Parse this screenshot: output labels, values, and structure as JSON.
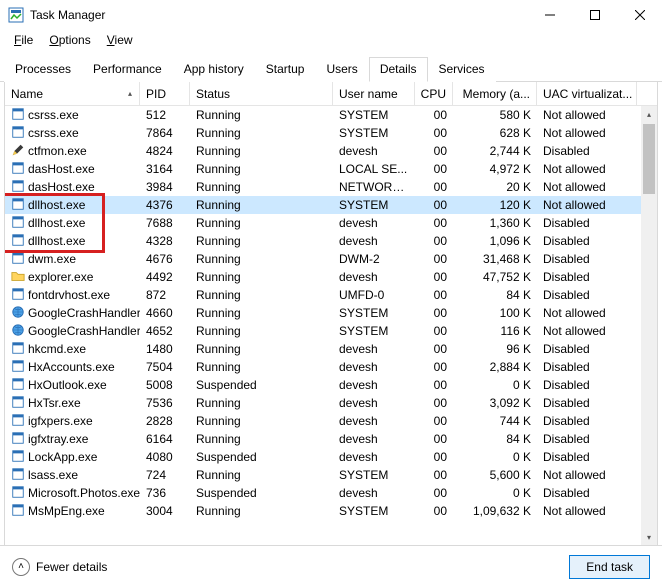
{
  "window": {
    "title": "Task Manager"
  },
  "menu": {
    "file": "File",
    "options": "Options",
    "view": "View"
  },
  "tabs": [
    "Processes",
    "Performance",
    "App history",
    "Startup",
    "Users",
    "Details",
    "Services"
  ],
  "active_tab_index": 5,
  "columns": {
    "name": "Name",
    "pid": "PID",
    "status": "Status",
    "user": "User name",
    "cpu": "CPU",
    "mem": "Memory (a...",
    "uac": "UAC virtualizat..."
  },
  "footer": {
    "fewer": "Fewer details",
    "endtask": "End task"
  },
  "rows": [
    {
      "name": "csrss.exe",
      "pid": "512",
      "status": "Running",
      "user": "SYSTEM",
      "cpu": "00",
      "mem": "580 K",
      "uac": "Not allowed",
      "icon": "app",
      "sel": false
    },
    {
      "name": "csrss.exe",
      "pid": "7864",
      "status": "Running",
      "user": "SYSTEM",
      "cpu": "00",
      "mem": "628 K",
      "uac": "Not allowed",
      "icon": "app",
      "sel": false
    },
    {
      "name": "ctfmon.exe",
      "pid": "4824",
      "status": "Running",
      "user": "devesh",
      "cpu": "00",
      "mem": "2,744 K",
      "uac": "Disabled",
      "icon": "pen",
      "sel": false
    },
    {
      "name": "dasHost.exe",
      "pid": "3164",
      "status": "Running",
      "user": "LOCAL SE...",
      "cpu": "00",
      "mem": "4,972 K",
      "uac": "Not allowed",
      "icon": "app",
      "sel": false
    },
    {
      "name": "dasHost.exe",
      "pid": "3984",
      "status": "Running",
      "user": "NETWORK...",
      "cpu": "00",
      "mem": "20 K",
      "uac": "Not allowed",
      "icon": "app",
      "sel": false
    },
    {
      "name": "dllhost.exe",
      "pid": "4376",
      "status": "Running",
      "user": "SYSTEM",
      "cpu": "00",
      "mem": "120 K",
      "uac": "Not allowed",
      "icon": "app",
      "sel": true
    },
    {
      "name": "dllhost.exe",
      "pid": "7688",
      "status": "Running",
      "user": "devesh",
      "cpu": "00",
      "mem": "1,360 K",
      "uac": "Disabled",
      "icon": "app",
      "sel": false
    },
    {
      "name": "dllhost.exe",
      "pid": "4328",
      "status": "Running",
      "user": "devesh",
      "cpu": "00",
      "mem": "1,096 K",
      "uac": "Disabled",
      "icon": "app",
      "sel": false
    },
    {
      "name": "dwm.exe",
      "pid": "4676",
      "status": "Running",
      "user": "DWM-2",
      "cpu": "00",
      "mem": "31,468 K",
      "uac": "Disabled",
      "icon": "app",
      "sel": false
    },
    {
      "name": "explorer.exe",
      "pid": "4492",
      "status": "Running",
      "user": "devesh",
      "cpu": "00",
      "mem": "47,752 K",
      "uac": "Disabled",
      "icon": "folder",
      "sel": false
    },
    {
      "name": "fontdrvhost.exe",
      "pid": "872",
      "status": "Running",
      "user": "UMFD-0",
      "cpu": "00",
      "mem": "84 K",
      "uac": "Disabled",
      "icon": "app",
      "sel": false
    },
    {
      "name": "GoogleCrashHandler...",
      "pid": "4660",
      "status": "Running",
      "user": "SYSTEM",
      "cpu": "00",
      "mem": "100 K",
      "uac": "Not allowed",
      "icon": "globe",
      "sel": false
    },
    {
      "name": "GoogleCrashHandler...",
      "pid": "4652",
      "status": "Running",
      "user": "SYSTEM",
      "cpu": "00",
      "mem": "116 K",
      "uac": "Not allowed",
      "icon": "globe",
      "sel": false
    },
    {
      "name": "hkcmd.exe",
      "pid": "1480",
      "status": "Running",
      "user": "devesh",
      "cpu": "00",
      "mem": "96 K",
      "uac": "Disabled",
      "icon": "app",
      "sel": false
    },
    {
      "name": "HxAccounts.exe",
      "pid": "7504",
      "status": "Running",
      "user": "devesh",
      "cpu": "00",
      "mem": "2,884 K",
      "uac": "Disabled",
      "icon": "app",
      "sel": false
    },
    {
      "name": "HxOutlook.exe",
      "pid": "5008",
      "status": "Suspended",
      "user": "devesh",
      "cpu": "00",
      "mem": "0 K",
      "uac": "Disabled",
      "icon": "app",
      "sel": false
    },
    {
      "name": "HxTsr.exe",
      "pid": "7536",
      "status": "Running",
      "user": "devesh",
      "cpu": "00",
      "mem": "3,092 K",
      "uac": "Disabled",
      "icon": "app",
      "sel": false
    },
    {
      "name": "igfxpers.exe",
      "pid": "2828",
      "status": "Running",
      "user": "devesh",
      "cpu": "00",
      "mem": "744 K",
      "uac": "Disabled",
      "icon": "app",
      "sel": false
    },
    {
      "name": "igfxtray.exe",
      "pid": "6164",
      "status": "Running",
      "user": "devesh",
      "cpu": "00",
      "mem": "84 K",
      "uac": "Disabled",
      "icon": "app",
      "sel": false
    },
    {
      "name": "LockApp.exe",
      "pid": "4080",
      "status": "Suspended",
      "user": "devesh",
      "cpu": "00",
      "mem": "0 K",
      "uac": "Disabled",
      "icon": "app",
      "sel": false
    },
    {
      "name": "lsass.exe",
      "pid": "724",
      "status": "Running",
      "user": "SYSTEM",
      "cpu": "00",
      "mem": "5,600 K",
      "uac": "Not allowed",
      "icon": "app",
      "sel": false
    },
    {
      "name": "Microsoft.Photos.exe",
      "pid": "736",
      "status": "Suspended",
      "user": "devesh",
      "cpu": "00",
      "mem": "0 K",
      "uac": "Disabled",
      "icon": "app",
      "sel": false
    },
    {
      "name": "MsMpEng.exe",
      "pid": "3004",
      "status": "Running",
      "user": "SYSTEM",
      "cpu": "00",
      "mem": "1,09,632 K",
      "uac": "Not allowed",
      "icon": "app",
      "sel": false
    }
  ]
}
